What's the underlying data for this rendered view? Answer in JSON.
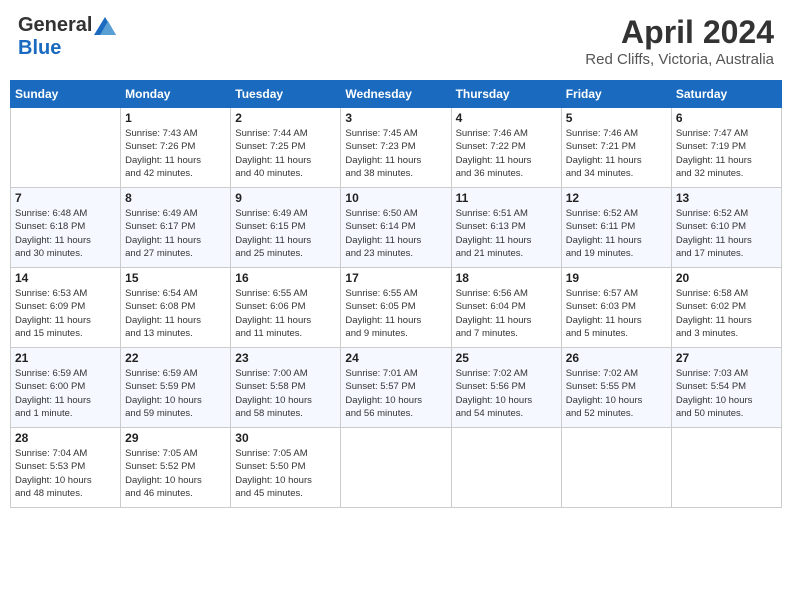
{
  "header": {
    "logo_general": "General",
    "logo_blue": "Blue",
    "month": "April 2024",
    "location": "Red Cliffs, Victoria, Australia"
  },
  "weekdays": [
    "Sunday",
    "Monday",
    "Tuesday",
    "Wednesday",
    "Thursday",
    "Friday",
    "Saturday"
  ],
  "weeks": [
    [
      {
        "day": "",
        "info": ""
      },
      {
        "day": "1",
        "info": "Sunrise: 7:43 AM\nSunset: 7:26 PM\nDaylight: 11 hours\nand 42 minutes."
      },
      {
        "day": "2",
        "info": "Sunrise: 7:44 AM\nSunset: 7:25 PM\nDaylight: 11 hours\nand 40 minutes."
      },
      {
        "day": "3",
        "info": "Sunrise: 7:45 AM\nSunset: 7:23 PM\nDaylight: 11 hours\nand 38 minutes."
      },
      {
        "day": "4",
        "info": "Sunrise: 7:46 AM\nSunset: 7:22 PM\nDaylight: 11 hours\nand 36 minutes."
      },
      {
        "day": "5",
        "info": "Sunrise: 7:46 AM\nSunset: 7:21 PM\nDaylight: 11 hours\nand 34 minutes."
      },
      {
        "day": "6",
        "info": "Sunrise: 7:47 AM\nSunset: 7:19 PM\nDaylight: 11 hours\nand 32 minutes."
      }
    ],
    [
      {
        "day": "7",
        "info": "Sunrise: 6:48 AM\nSunset: 6:18 PM\nDaylight: 11 hours\nand 30 minutes."
      },
      {
        "day": "8",
        "info": "Sunrise: 6:49 AM\nSunset: 6:17 PM\nDaylight: 11 hours\nand 27 minutes."
      },
      {
        "day": "9",
        "info": "Sunrise: 6:49 AM\nSunset: 6:15 PM\nDaylight: 11 hours\nand 25 minutes."
      },
      {
        "day": "10",
        "info": "Sunrise: 6:50 AM\nSunset: 6:14 PM\nDaylight: 11 hours\nand 23 minutes."
      },
      {
        "day": "11",
        "info": "Sunrise: 6:51 AM\nSunset: 6:13 PM\nDaylight: 11 hours\nand 21 minutes."
      },
      {
        "day": "12",
        "info": "Sunrise: 6:52 AM\nSunset: 6:11 PM\nDaylight: 11 hours\nand 19 minutes."
      },
      {
        "day": "13",
        "info": "Sunrise: 6:52 AM\nSunset: 6:10 PM\nDaylight: 11 hours\nand 17 minutes."
      }
    ],
    [
      {
        "day": "14",
        "info": "Sunrise: 6:53 AM\nSunset: 6:09 PM\nDaylight: 11 hours\nand 15 minutes."
      },
      {
        "day": "15",
        "info": "Sunrise: 6:54 AM\nSunset: 6:08 PM\nDaylight: 11 hours\nand 13 minutes."
      },
      {
        "day": "16",
        "info": "Sunrise: 6:55 AM\nSunset: 6:06 PM\nDaylight: 11 hours\nand 11 minutes."
      },
      {
        "day": "17",
        "info": "Sunrise: 6:55 AM\nSunset: 6:05 PM\nDaylight: 11 hours\nand 9 minutes."
      },
      {
        "day": "18",
        "info": "Sunrise: 6:56 AM\nSunset: 6:04 PM\nDaylight: 11 hours\nand 7 minutes."
      },
      {
        "day": "19",
        "info": "Sunrise: 6:57 AM\nSunset: 6:03 PM\nDaylight: 11 hours\nand 5 minutes."
      },
      {
        "day": "20",
        "info": "Sunrise: 6:58 AM\nSunset: 6:02 PM\nDaylight: 11 hours\nand 3 minutes."
      }
    ],
    [
      {
        "day": "21",
        "info": "Sunrise: 6:59 AM\nSunset: 6:00 PM\nDaylight: 11 hours\nand 1 minute."
      },
      {
        "day": "22",
        "info": "Sunrise: 6:59 AM\nSunset: 5:59 PM\nDaylight: 10 hours\nand 59 minutes."
      },
      {
        "day": "23",
        "info": "Sunrise: 7:00 AM\nSunset: 5:58 PM\nDaylight: 10 hours\nand 58 minutes."
      },
      {
        "day": "24",
        "info": "Sunrise: 7:01 AM\nSunset: 5:57 PM\nDaylight: 10 hours\nand 56 minutes."
      },
      {
        "day": "25",
        "info": "Sunrise: 7:02 AM\nSunset: 5:56 PM\nDaylight: 10 hours\nand 54 minutes."
      },
      {
        "day": "26",
        "info": "Sunrise: 7:02 AM\nSunset: 5:55 PM\nDaylight: 10 hours\nand 52 minutes."
      },
      {
        "day": "27",
        "info": "Sunrise: 7:03 AM\nSunset: 5:54 PM\nDaylight: 10 hours\nand 50 minutes."
      }
    ],
    [
      {
        "day": "28",
        "info": "Sunrise: 7:04 AM\nSunset: 5:53 PM\nDaylight: 10 hours\nand 48 minutes."
      },
      {
        "day": "29",
        "info": "Sunrise: 7:05 AM\nSunset: 5:52 PM\nDaylight: 10 hours\nand 46 minutes."
      },
      {
        "day": "30",
        "info": "Sunrise: 7:05 AM\nSunset: 5:50 PM\nDaylight: 10 hours\nand 45 minutes."
      },
      {
        "day": "",
        "info": ""
      },
      {
        "day": "",
        "info": ""
      },
      {
        "day": "",
        "info": ""
      },
      {
        "day": "",
        "info": ""
      }
    ]
  ]
}
